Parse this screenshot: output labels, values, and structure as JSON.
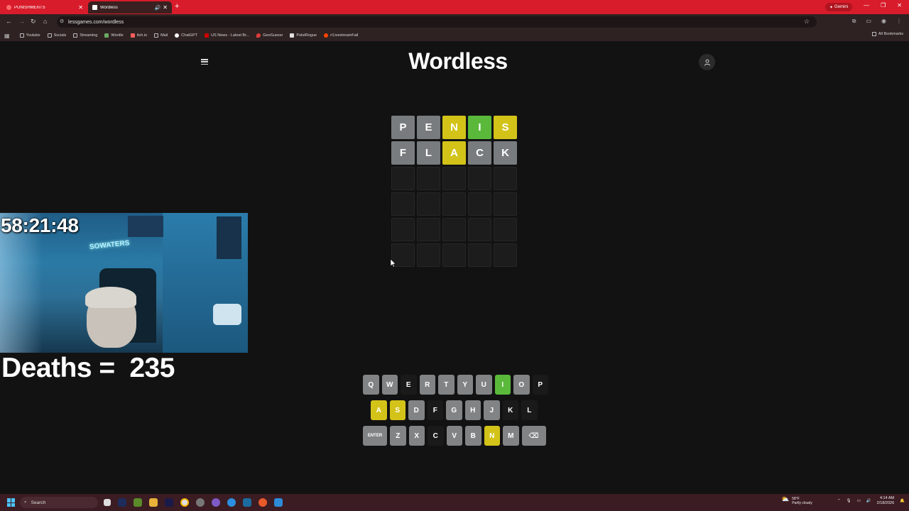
{
  "browser": {
    "tabs": [
      {
        "title": "PUNISHMENTS",
        "active": false,
        "fav_color": "#ff6b6b"
      },
      {
        "title": "Wordless",
        "active": true,
        "fav_color": "#ffffff"
      }
    ],
    "new_tab": "+",
    "gemini_label": "Gemini",
    "url": "lessgames.com/wordless",
    "bookmarks": [
      {
        "label": "Youtube",
        "color": "#bbbbbb"
      },
      {
        "label": "Socials",
        "color": "#bbbbbb"
      },
      {
        "label": "Streaming",
        "color": "#bbbbbb"
      },
      {
        "label": "Wordle",
        "color": "#6aaa64"
      },
      {
        "label": "itch.io",
        "color": "#fa5c5c"
      },
      {
        "label": "Mail",
        "color": "#bbbbbb"
      },
      {
        "label": "ChatGPT",
        "color": "#ffffff"
      },
      {
        "label": "US News - Latest Br...",
        "color": "#cc0000"
      },
      {
        "label": "GeoGuessr",
        "color": "#e03c3c"
      },
      {
        "label": "PokéRogue",
        "color": "#e0e0e0"
      },
      {
        "label": "r/LivestreamFail",
        "color": "#ff4500"
      }
    ],
    "all_bookmarks": "All Bookmarks"
  },
  "game": {
    "title": "Wordless",
    "board": [
      [
        {
          "l": "P",
          "s": "gray"
        },
        {
          "l": "E",
          "s": "gray"
        },
        {
          "l": "N",
          "s": "yellow"
        },
        {
          "l": "I",
          "s": "green"
        },
        {
          "l": "S",
          "s": "yellow"
        }
      ],
      [
        {
          "l": "F",
          "s": "gray"
        },
        {
          "l": "L",
          "s": "gray"
        },
        {
          "l": "A",
          "s": "yellow"
        },
        {
          "l": "C",
          "s": "gray"
        },
        {
          "l": "K",
          "s": "gray"
        }
      ],
      [
        {
          "l": "",
          "s": "empty"
        },
        {
          "l": "",
          "s": "empty"
        },
        {
          "l": "",
          "s": "empty"
        },
        {
          "l": "",
          "s": "empty"
        },
        {
          "l": "",
          "s": "empty"
        }
      ],
      [
        {
          "l": "",
          "s": "empty"
        },
        {
          "l": "",
          "s": "empty"
        },
        {
          "l": "",
          "s": "empty"
        },
        {
          "l": "",
          "s": "empty"
        },
        {
          "l": "",
          "s": "empty"
        }
      ],
      [
        {
          "l": "",
          "s": "empty"
        },
        {
          "l": "",
          "s": "empty"
        },
        {
          "l": "",
          "s": "empty"
        },
        {
          "l": "",
          "s": "empty"
        },
        {
          "l": "",
          "s": "empty"
        }
      ],
      [
        {
          "l": "",
          "s": "empty"
        },
        {
          "l": "",
          "s": "empty"
        },
        {
          "l": "",
          "s": "empty"
        },
        {
          "l": "",
          "s": "empty"
        },
        {
          "l": "",
          "s": "empty"
        }
      ]
    ],
    "keyboard": [
      [
        {
          "k": "Q",
          "s": "gray"
        },
        {
          "k": "W",
          "s": "gray"
        },
        {
          "k": "E",
          "s": "absent"
        },
        {
          "k": "R",
          "s": "gray"
        },
        {
          "k": "T",
          "s": "gray"
        },
        {
          "k": "Y",
          "s": "gray"
        },
        {
          "k": "U",
          "s": "gray"
        },
        {
          "k": "I",
          "s": "green"
        },
        {
          "k": "O",
          "s": "gray"
        },
        {
          "k": "P",
          "s": "absent"
        }
      ],
      [
        {
          "k": "A",
          "s": "yellow"
        },
        {
          "k": "S",
          "s": "yellow"
        },
        {
          "k": "D",
          "s": "gray"
        },
        {
          "k": "F",
          "s": "absent"
        },
        {
          "k": "G",
          "s": "gray"
        },
        {
          "k": "H",
          "s": "gray"
        },
        {
          "k": "J",
          "s": "gray"
        },
        {
          "k": "K",
          "s": "absent"
        },
        {
          "k": "L",
          "s": "absent"
        }
      ],
      [
        {
          "k": "ENTER",
          "s": "gray",
          "wide": true
        },
        {
          "k": "Z",
          "s": "gray"
        },
        {
          "k": "X",
          "s": "gray"
        },
        {
          "k": "C",
          "s": "absent"
        },
        {
          "k": "V",
          "s": "gray"
        },
        {
          "k": "B",
          "s": "gray"
        },
        {
          "k": "N",
          "s": "yellow"
        },
        {
          "k": "M",
          "s": "gray"
        },
        {
          "k": "⌫",
          "s": "gray",
          "back": true
        }
      ]
    ]
  },
  "overlay": {
    "timer": "58:21:48",
    "deaths": "Deaths =  235",
    "neon_sign": "SOWATERS"
  },
  "taskbar": {
    "search": "Search",
    "weather_temp": "58°F",
    "weather_desc": "Partly cloudy",
    "time": "4:14 AM",
    "date": "2/18/2026"
  }
}
